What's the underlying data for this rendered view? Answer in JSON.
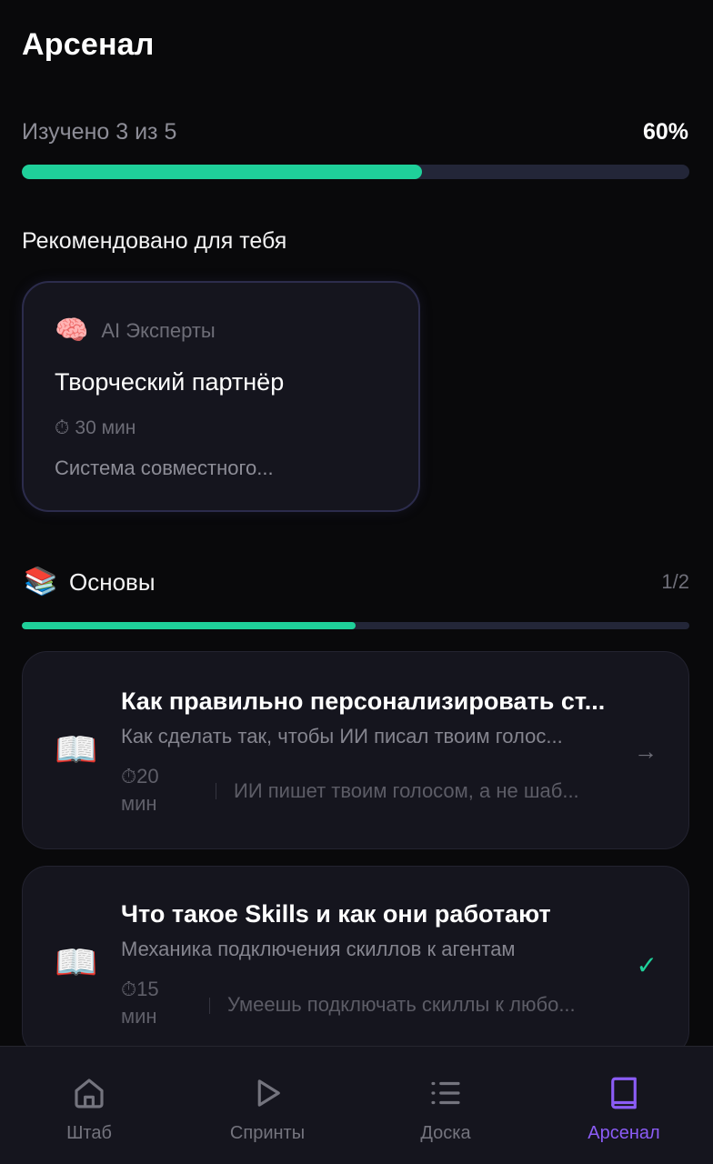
{
  "header": {
    "title": "Арсенал"
  },
  "progress": {
    "label": "Изучено 3 из 5",
    "percent_text": "60%",
    "fraction": 0.6,
    "color": "#1fd09a"
  },
  "recommended": {
    "section_title": "Рекомендовано для тебя",
    "card": {
      "category_icon": "brain-icon",
      "category": "AI Эксперты",
      "title": "Творческий партнёр",
      "duration": "30 мин",
      "description": "Система совместного..."
    }
  },
  "group": {
    "icon": "books-icon",
    "name": "Основы",
    "count": "1/2",
    "fraction": 0.5,
    "lessons": [
      {
        "icon": "book-icon",
        "title": "Как правильно персонализировать ст...",
        "subtitle": "Как сделать так, чтобы ИИ писал твоим голос...",
        "duration": "20 мин",
        "note": "ИИ пишет твоим голосом, а не шаб...",
        "action": "→",
        "done": false
      },
      {
        "icon": "book-icon",
        "title": "Что такое Skills и как они работают",
        "subtitle": "Механика подключения скиллов к агентам",
        "duration": "15 мин",
        "note": "Умеешь подключать скиллы к любо...",
        "action": "✓",
        "done": true
      }
    ]
  },
  "nav": {
    "items": [
      {
        "label": "Штаб",
        "icon": "home-icon",
        "active": false
      },
      {
        "label": "Спринты",
        "icon": "play-icon",
        "active": false
      },
      {
        "label": "Доска",
        "icon": "list-icon",
        "active": false
      },
      {
        "label": "Арсенал",
        "icon": "book-icon",
        "active": true
      }
    ],
    "active_color": "#8b5cf6",
    "inactive_color": "#74747e"
  }
}
